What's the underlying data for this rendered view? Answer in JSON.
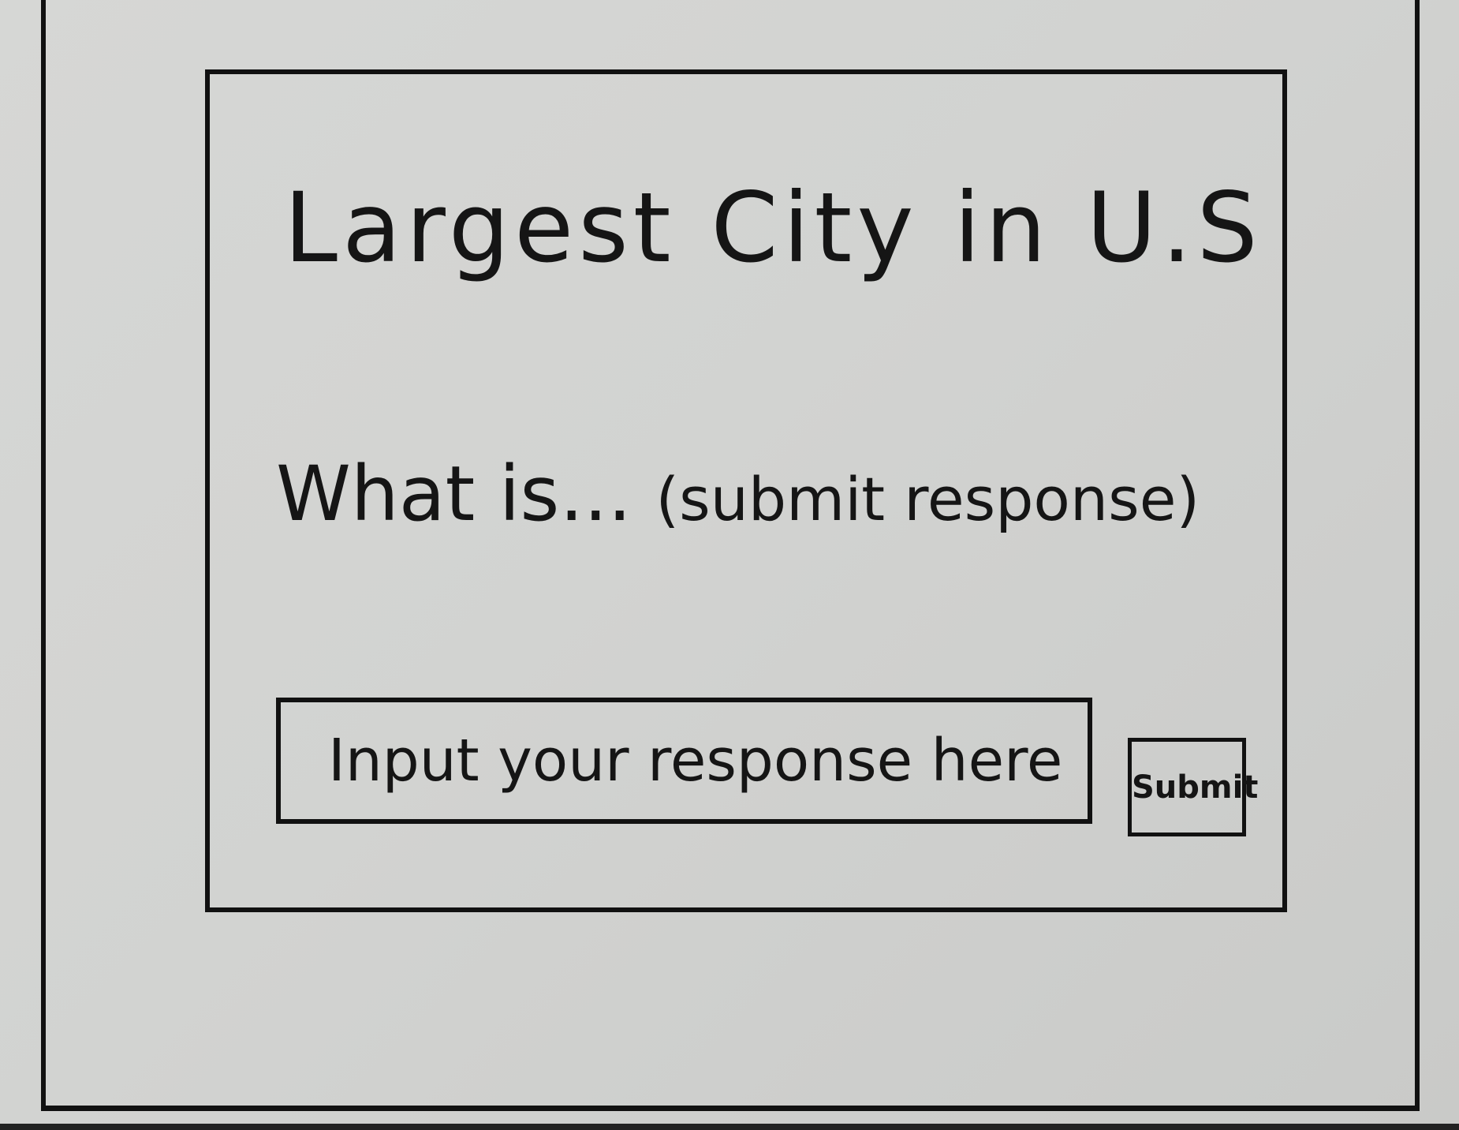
{
  "dialog": {
    "title": "Largest City in U.S",
    "prompt": "What is...",
    "prompt_hint": "(submit response)"
  },
  "response": {
    "placeholder": "Input your response here",
    "value": ""
  },
  "submit": {
    "label": "Submit"
  }
}
